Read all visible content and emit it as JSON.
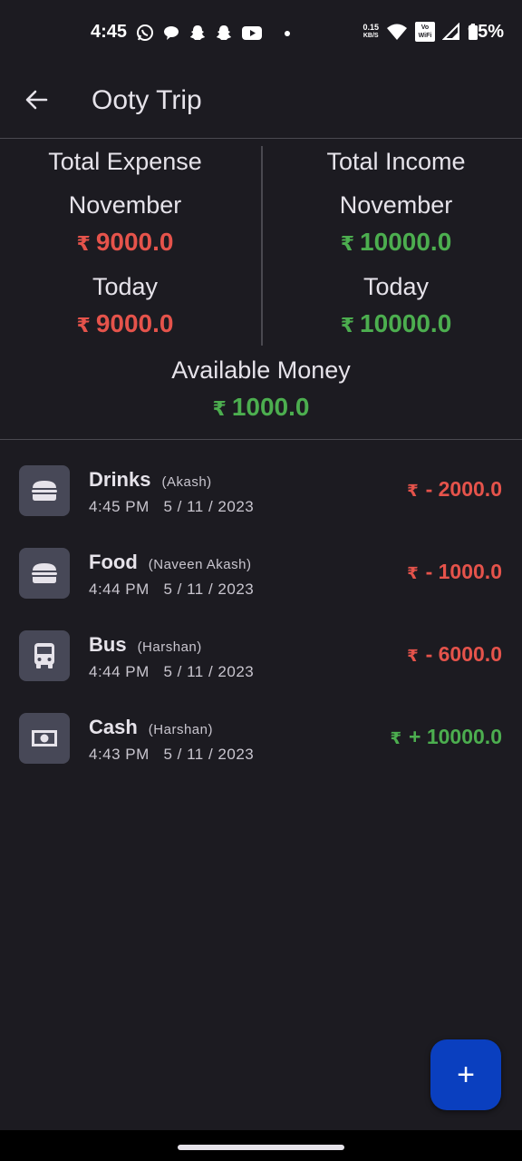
{
  "status_bar": {
    "time": "4:45",
    "speed_value": "0.15",
    "speed_unit": "KB/S",
    "wifi_calling": "Vo WiFi",
    "battery_percent": "95%",
    "icons_left": [
      "whatsapp-icon",
      "chat-icon",
      "snapchat-icon",
      "snapchat-icon",
      "youtube-icon",
      "dot-icon"
    ],
    "icons_right": [
      "wifi-icon",
      "vowifi-icon",
      "signal-icon",
      "battery-icon"
    ]
  },
  "appbar": {
    "title": "Ooty Trip"
  },
  "summary": {
    "expense": {
      "heading": "Total Expense",
      "month_label": "November",
      "month_amount": "9000.0",
      "today_label": "Today",
      "today_amount": "9000.0"
    },
    "income": {
      "heading": "Total Income",
      "month_label": "November",
      "month_amount": "10000.0",
      "today_label": "Today",
      "today_amount": "10000.0"
    },
    "available": {
      "label": "Available Money",
      "amount": "1000.0"
    },
    "currency_symbol": "₹"
  },
  "transactions": [
    {
      "name": "Drinks",
      "person": "(Akash)",
      "time": "4:45 PM",
      "date": "5 / 11 / 2023",
      "amount": "- 2000.0",
      "type": "expense",
      "icon": "burger-icon"
    },
    {
      "name": "Food",
      "person": "(Naveen Akash)",
      "time": "4:44 PM",
      "date": "5 / 11 / 2023",
      "amount": "- 1000.0",
      "type": "expense",
      "icon": "burger-icon"
    },
    {
      "name": "Bus",
      "person": "(Harshan)",
      "time": "4:44 PM",
      "date": "5 / 11 / 2023",
      "amount": "- 6000.0",
      "type": "expense",
      "icon": "bus-icon"
    },
    {
      "name": "Cash",
      "person": "(Harshan)",
      "time": "4:43 PM",
      "date": "5 / 11 / 2023",
      "amount": "+ 10000.0",
      "type": "income",
      "icon": "cash-icon"
    }
  ],
  "fab": {
    "label": "+"
  },
  "colors": {
    "background": "#1c1b21",
    "expense": "#e5534b",
    "income": "#4cae4f",
    "tile": "#474857",
    "fab": "#0a3fbf"
  }
}
